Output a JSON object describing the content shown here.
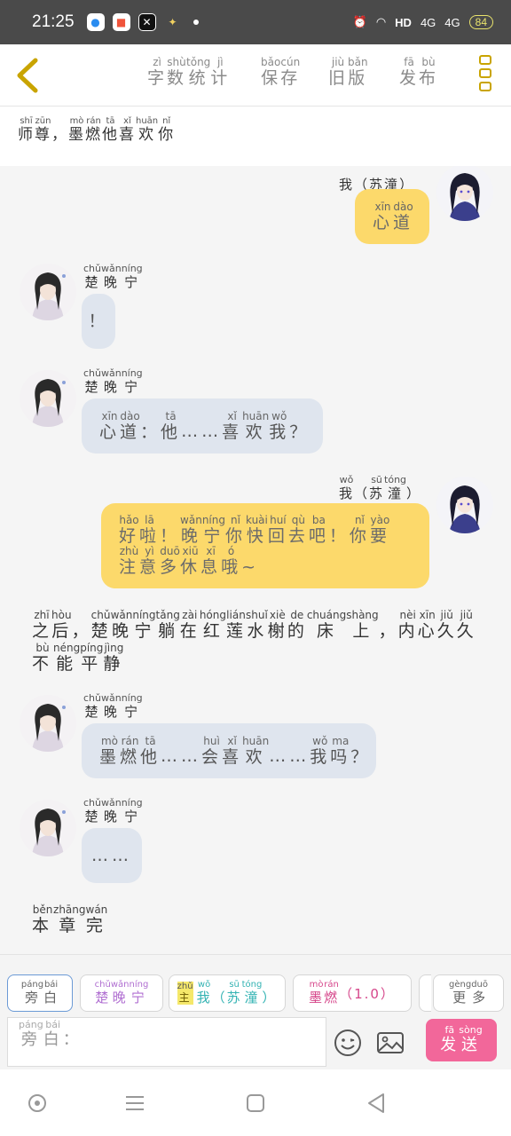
{
  "status_bar": {
    "time": "21:25",
    "icons": [
      "bubble-app-icon",
      "red-app-icon",
      "capcut-icon",
      "bulb-icon"
    ],
    "right_icons": [
      "alarm-icon",
      "wifi-icon"
    ],
    "hd": "HD",
    "network_1": "4G",
    "network_2": "4G",
    "battery": "84",
    "colors": {
      "bg": "#4a4a4a",
      "battery": "#e9e36c"
    }
  },
  "nav": {
    "items": [
      {
        "label": "字数统计",
        "pinyin": [
          "zì",
          "shù",
          "tǒng",
          "jì"
        ]
      },
      {
        "label": "保存",
        "pinyin": [
          "bǎo",
          "cún"
        ]
      },
      {
        "label": "旧版",
        "pinyin": [
          "jiù",
          "bǎn"
        ]
      },
      {
        "label": "发布",
        "pinyin": [
          "fā",
          "bù"
        ]
      }
    ],
    "accent": "#c9a400"
  },
  "title": {
    "chars": [
      "师",
      "尊",
      "，",
      "墨",
      "燃",
      "他",
      "喜",
      "欢",
      "你"
    ],
    "pinyin": [
      "shī",
      "zūn",
      "",
      "mò",
      "rán",
      "tā",
      "xǐ",
      "huān",
      "nǐ"
    ]
  },
  "messages": [
    {
      "side": "right",
      "name": "我（苏潼）",
      "name_pinyin": [],
      "chars": [
        "心",
        "道"
      ],
      "pinyin": [
        "xīn",
        "dào"
      ]
    },
    {
      "side": "left",
      "name_chars": [
        "楚",
        "晚",
        "宁"
      ],
      "name_pinyin": [
        "chǔ",
        "wǎn",
        "níng"
      ],
      "text": "！"
    },
    {
      "side": "left",
      "name_chars": [
        "楚",
        "晚",
        "宁"
      ],
      "name_pinyin": [
        "chǔ",
        "wǎn",
        "níng"
      ],
      "chars": [
        "心",
        "道",
        "：",
        "他",
        "……",
        "喜",
        "欢",
        "我",
        "？"
      ],
      "pinyin": [
        "xīn",
        "dào",
        "",
        "tā",
        "",
        "xǐ",
        "huān",
        "wǒ",
        ""
      ]
    },
    {
      "side": "right",
      "name_chars": [
        "我",
        "（",
        "苏",
        "潼",
        "）"
      ],
      "name_pinyin": [
        "wǒ",
        "",
        "sū",
        "tóng",
        ""
      ],
      "line1_chars": [
        "好",
        "啦",
        "！",
        "晚",
        "宁",
        "你",
        "快",
        "回",
        "去",
        "吧",
        "！",
        "你",
        "要"
      ],
      "line1_pinyin": [
        "hǎo",
        "lā",
        "",
        "wǎn",
        "níng",
        "nǐ",
        "kuài",
        "huí",
        "qù",
        "ba",
        "",
        "nǐ",
        "yào"
      ],
      "line2_chars": [
        "注",
        "意",
        "多",
        "休",
        "息",
        "哦",
        "~"
      ],
      "line2_pinyin": [
        "zhù",
        "yì",
        "duō",
        "xiū",
        "xī",
        "ó",
        ""
      ]
    },
    {
      "side": "narration",
      "line1_chars": [
        "之",
        "后",
        "，",
        "楚",
        "晚",
        "宁",
        "躺",
        "在",
        "红",
        "莲",
        "水",
        "榭",
        "的",
        "床",
        "上",
        "，",
        "内",
        "心",
        "久",
        "久"
      ],
      "line1_pinyin": [
        "zhī",
        "hòu",
        "",
        "chǔ",
        "wǎn",
        "níng",
        "tǎng",
        "zài",
        "hóng",
        "lián",
        "shuǐ",
        "xiè",
        "de",
        "chuáng",
        "shàng",
        "",
        "nèi",
        "xīn",
        "jiǔ",
        "jiǔ"
      ],
      "line2_chars": [
        "不",
        "能",
        "平",
        "静"
      ],
      "line2_pinyin": [
        "bù",
        "néng",
        "píng",
        "jìng"
      ]
    },
    {
      "side": "left",
      "name_chars": [
        "楚",
        "晚",
        "宁"
      ],
      "name_pinyin": [
        "chǔ",
        "wǎn",
        "níng"
      ],
      "chars": [
        "墨",
        "燃",
        "他",
        "……",
        "会",
        "喜",
        "欢",
        "……",
        "我",
        "吗",
        "？"
      ],
      "pinyin": [
        "mò",
        "rán",
        "tā",
        "",
        "huì",
        "xǐ",
        "huān",
        "",
        "wǒ",
        "ma",
        ""
      ]
    },
    {
      "side": "left",
      "name_chars": [
        "楚",
        "晚",
        "宁"
      ],
      "name_pinyin": [
        "chǔ",
        "wǎn",
        "níng"
      ],
      "text": "……"
    },
    {
      "side": "narration",
      "line1_chars": [
        "本",
        "章",
        "完"
      ],
      "line1_pinyin": [
        "běn",
        "zhāng",
        "wán"
      ]
    }
  ],
  "my_name_top": {
    "chars": [
      "我",
      "（",
      "苏",
      "潼",
      "）"
    ]
  },
  "chips": [
    {
      "chars": [
        "旁",
        "白"
      ],
      "pinyin": [
        "páng",
        "bái"
      ],
      "color": "#666666",
      "active": true
    },
    {
      "chars": [
        "楚",
        "晚",
        "宁"
      ],
      "pinyin": [
        "chǔ",
        "wǎn",
        "níng"
      ],
      "color": "#b06fd1"
    },
    {
      "badge": "主",
      "badge_pinyin": "zhǔ",
      "chars": [
        "我",
        "（",
        "苏",
        "潼",
        "）"
      ],
      "pinyin": [
        "wǒ",
        "",
        "sū",
        "tóng",
        ""
      ],
      "color": "#33b3b3"
    },
    {
      "chars": [
        "墨",
        "燃"
      ],
      "pinyin": [
        "mò",
        "rán"
      ],
      "suffix": "（1.0）",
      "color": "#d6478b"
    },
    {
      "chars": [
        "更",
        "多"
      ],
      "pinyin": [
        "gèng",
        "duō"
      ],
      "color": "#666666"
    }
  ],
  "composer": {
    "chars": [
      "旁",
      "白",
      "："
    ],
    "pinyin": [
      "páng",
      "bái",
      ""
    ],
    "send_chars": [
      "发",
      "送"
    ],
    "send_pinyin": [
      "fā",
      "sòng"
    ],
    "send_color": "#f2679a"
  }
}
